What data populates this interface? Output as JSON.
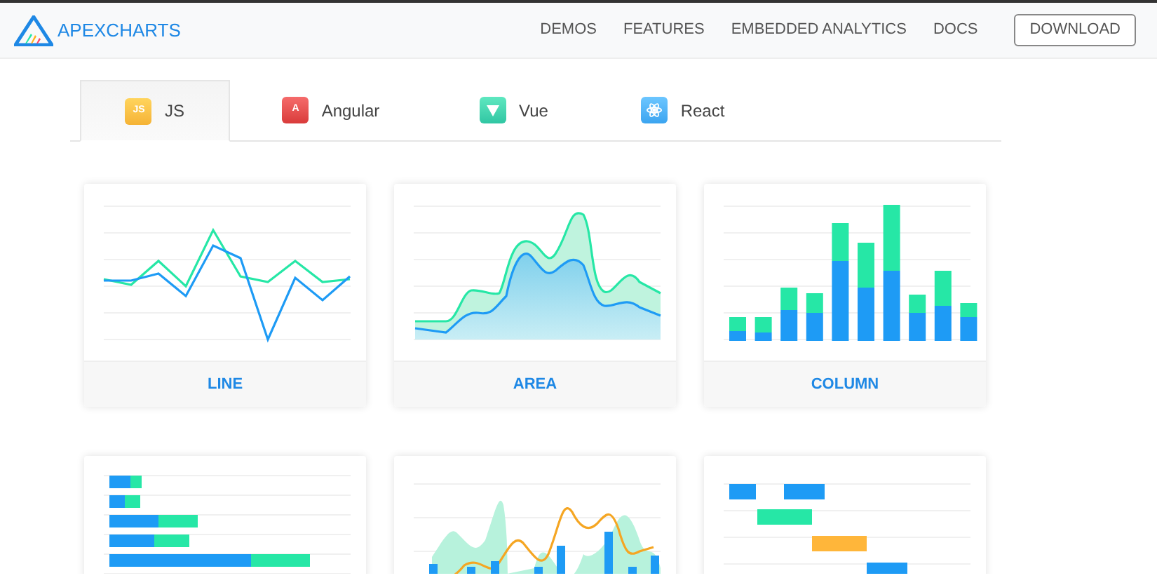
{
  "brand": {
    "name": "APEXCHARTS"
  },
  "nav": {
    "links": [
      "DEMOS",
      "FEATURES",
      "EMBEDDED ANALYTICS",
      "DOCS"
    ],
    "button": "DOWNLOAD"
  },
  "tabs": [
    {
      "label": "JS",
      "kind": "js",
      "icon_text": "JS",
      "selected": true
    },
    {
      "label": "Angular",
      "kind": "angular",
      "icon_text": "A",
      "selected": false
    },
    {
      "label": "Vue",
      "kind": "vue",
      "selected": false
    },
    {
      "label": "React",
      "kind": "react",
      "selected": false
    }
  ],
  "cards": [
    {
      "kind": "line",
      "label": "LINE"
    },
    {
      "kind": "area",
      "label": "AREA"
    },
    {
      "kind": "column",
      "label": "COLUMN"
    },
    {
      "kind": "bar"
    },
    {
      "kind": "mixed"
    },
    {
      "kind": "timeline"
    }
  ]
}
